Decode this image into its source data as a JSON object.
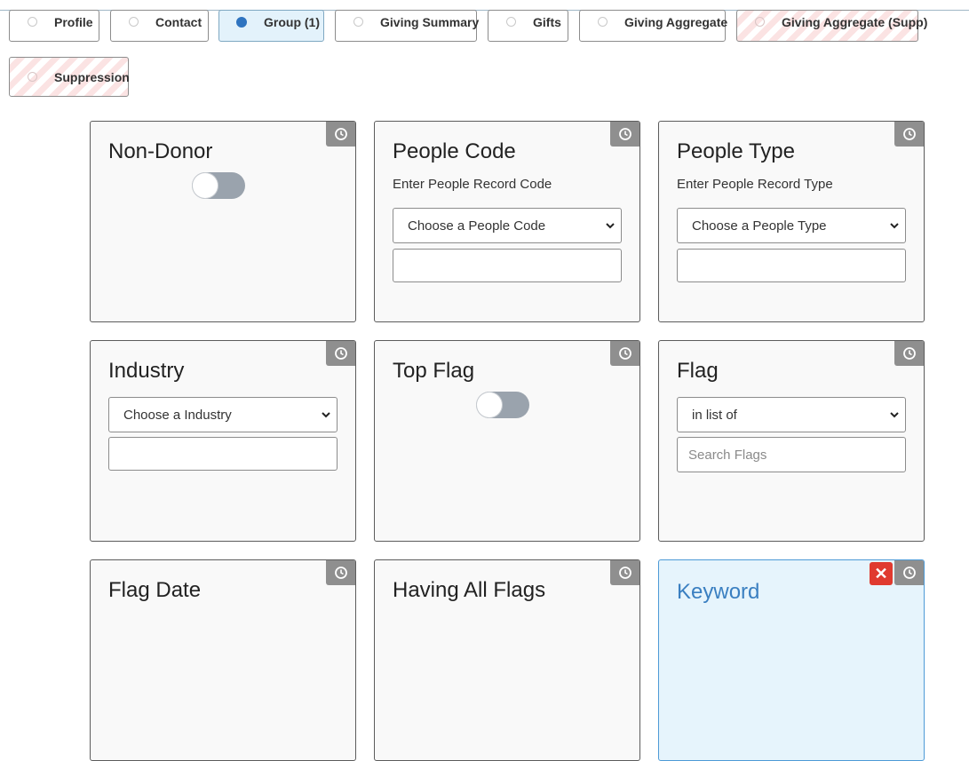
{
  "tabs": [
    {
      "label": "Profile",
      "state": "default"
    },
    {
      "label": "Contact",
      "state": "default"
    },
    {
      "label": "Group (1)",
      "state": "selected"
    },
    {
      "label": "Giving Summary",
      "state": "default"
    },
    {
      "label": "Gifts",
      "state": "default"
    },
    {
      "label": "Giving Aggregate",
      "state": "default"
    },
    {
      "label": "Giving Aggregate (Supp)",
      "state": "disabled"
    },
    {
      "label": "Suppression",
      "state": "disabled"
    }
  ],
  "cards": {
    "non_donor": {
      "title": "Non-Donor",
      "toggle_on": false
    },
    "people_code": {
      "title": "People Code",
      "subtitle": "Enter People Record Code",
      "select_value": "Choose a People Code",
      "input_value": ""
    },
    "people_type": {
      "title": "People Type",
      "subtitle": "Enter People Record Type",
      "select_value": "Choose a People Type",
      "input_value": ""
    },
    "industry": {
      "title": "Industry",
      "select_value": "Choose a Industry",
      "input_value": ""
    },
    "top_flag": {
      "title": "Top Flag",
      "toggle_on": false
    },
    "flag": {
      "title": "Flag",
      "select_value": "in list of",
      "search_placeholder": "Search Flags"
    },
    "flag_date": {
      "title": "Flag Date"
    },
    "having_all_flags": {
      "title": "Having All Flags"
    },
    "keyword": {
      "title": "Keyword",
      "delete_label": "✕"
    }
  },
  "icons": {
    "history": "clock-icon",
    "remove": "close-icon",
    "dropdown": "chevron-down-icon"
  },
  "colors": {
    "accent": "#2f74c0",
    "delete": "#e03a2f",
    "history_button": "#8f8f8f",
    "highlight_card": "#e6f4fc"
  }
}
